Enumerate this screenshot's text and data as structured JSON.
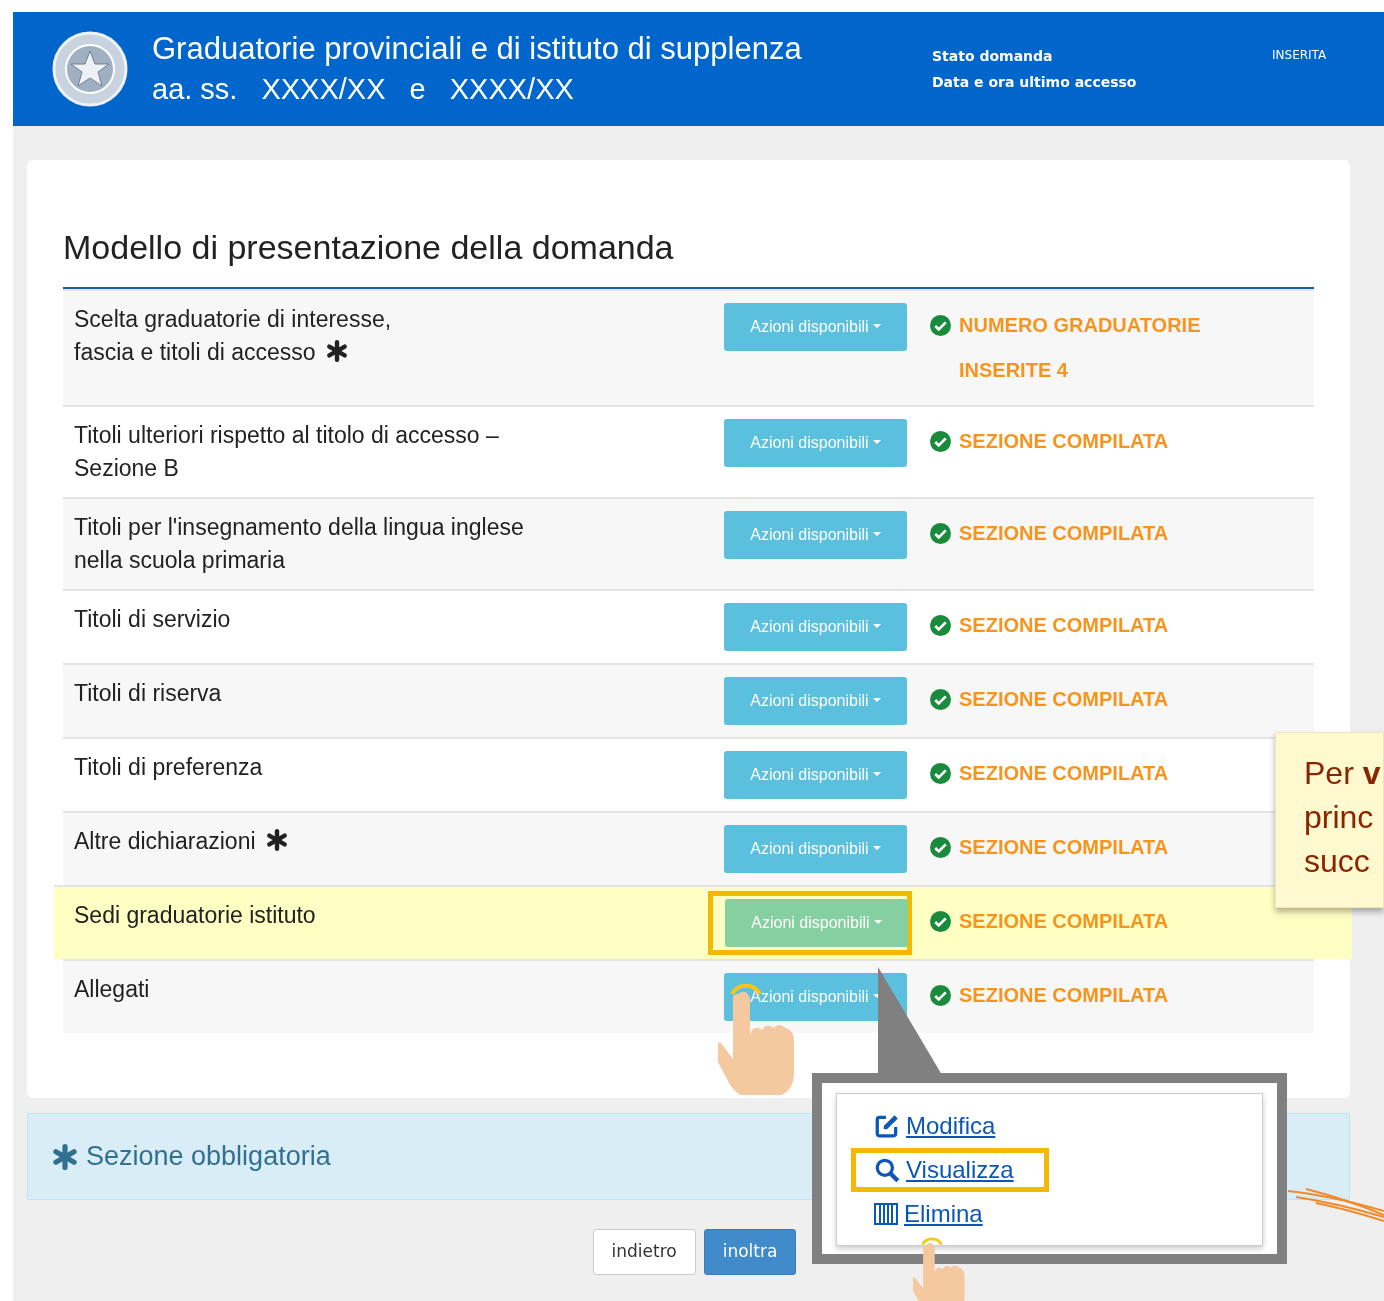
{
  "header": {
    "title": "Graduatorie provinciali e di istituto di supplenza",
    "subtitle_parts": [
      "aa. ss.",
      "XXXX/XX",
      "e",
      "XXXX/XX"
    ],
    "status_labels": [
      "Stato domanda",
      "Data e ora ultimo accesso"
    ],
    "status_value": "INSERITA"
  },
  "card": {
    "title": "Modello di presentazione della domanda"
  },
  "sections": [
    {
      "label_lines": [
        "Scelta graduatorie di interesse,",
        "fascia e titoli di accesso"
      ],
      "required": true,
      "button": "Azioni disponibili",
      "status": "NUMERO GRADUATORIE INSERITE 4",
      "highlighted": false
    },
    {
      "label_lines": [
        "Titoli ulteriori rispetto al titolo di accesso –",
        "Sezione B"
      ],
      "required": false,
      "button": "Azioni disponibili",
      "status": "SEZIONE COMPILATA",
      "highlighted": false
    },
    {
      "label_lines": [
        "Titoli per l'insegnamento della lingua inglese",
        "nella scuola primaria"
      ],
      "required": false,
      "button": "Azioni disponibili",
      "status": "SEZIONE COMPILATA",
      "highlighted": false
    },
    {
      "label_lines": [
        "Titoli di servizio"
      ],
      "required": false,
      "button": "Azioni disponibili",
      "status": "SEZIONE COMPILATA",
      "highlighted": false
    },
    {
      "label_lines": [
        "Titoli di riserva"
      ],
      "required": false,
      "button": "Azioni disponibili",
      "status": "SEZIONE COMPILATA",
      "highlighted": false
    },
    {
      "label_lines": [
        "Titoli di preferenza"
      ],
      "required": false,
      "button": "Azioni disponibili",
      "status": "SEZIONE COMPILATA",
      "highlighted": false
    },
    {
      "label_lines": [
        "Altre dichiarazioni"
      ],
      "required": true,
      "button": "Azioni disponibili",
      "status": "SEZIONE COMPILATA",
      "highlighted": false
    },
    {
      "label_lines": [
        "Sedi graduatorie istituto"
      ],
      "required": false,
      "button": "Azioni disponibili",
      "status": "SEZIONE COMPILATA",
      "highlighted": true
    },
    {
      "label_lines": [
        "Allegati"
      ],
      "required": false,
      "button": "Azioni disponibili",
      "status": "SEZIONE COMPILATA",
      "highlighted": false
    }
  ],
  "note": "Sezione obbligatoria",
  "buttons": [
    {
      "label": "indietro",
      "kind": "secondary"
    },
    {
      "label": "inoltra",
      "kind": "primary"
    }
  ],
  "menu": {
    "items": [
      {
        "label": "Modifica",
        "kind": "edit",
        "selected": false
      },
      {
        "label": "Visualizza",
        "kind": "view",
        "selected": true
      },
      {
        "label": "Elimina",
        "kind": "delete",
        "selected": false
      }
    ]
  },
  "tooltip": {
    "lines": [
      "Per **v**",
      "princ",
      "succ"
    ]
  }
}
